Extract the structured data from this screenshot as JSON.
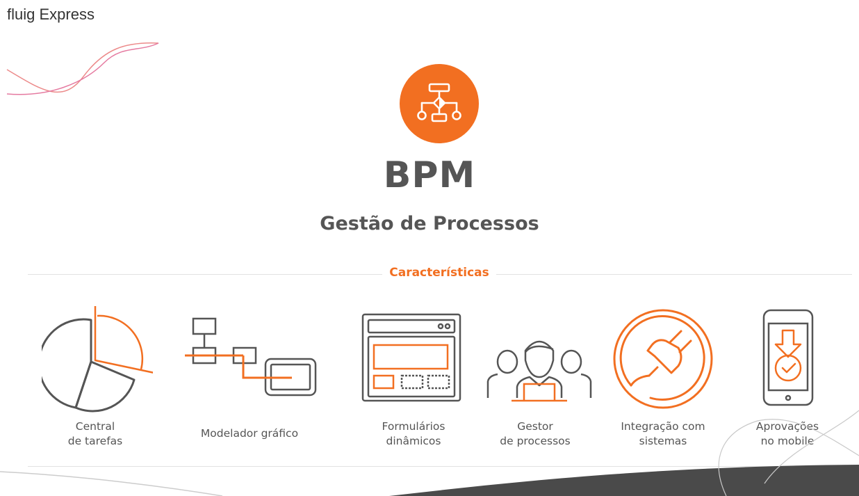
{
  "app": {
    "title": "fluig Express"
  },
  "hero": {
    "icon": "process-flow-icon",
    "title": "BPM",
    "subtitle": "Gestão de Processos"
  },
  "section": {
    "label": "Características"
  },
  "features": [
    {
      "line1": "Central",
      "line2": "de tarefas",
      "icon": "pie-chart-icon"
    },
    {
      "line1": "Modelador gráfico",
      "line2": "",
      "icon": "process-modeler-icon"
    },
    {
      "line1": "Formulários",
      "line2": "dinâmicos",
      "icon": "form-icon"
    },
    {
      "line1": "Gestor",
      "line2": "de processos",
      "icon": "people-manager-icon"
    },
    {
      "line1": "Integração com",
      "line2": "sistemas",
      "icon": "plug-icon"
    },
    {
      "line1": "Aprovações",
      "line2": "no mobile",
      "icon": "mobile-approval-icon"
    }
  ],
  "colors": {
    "accent": "#f26f21",
    "text": "#555555",
    "dark": "#4a4a4a"
  }
}
